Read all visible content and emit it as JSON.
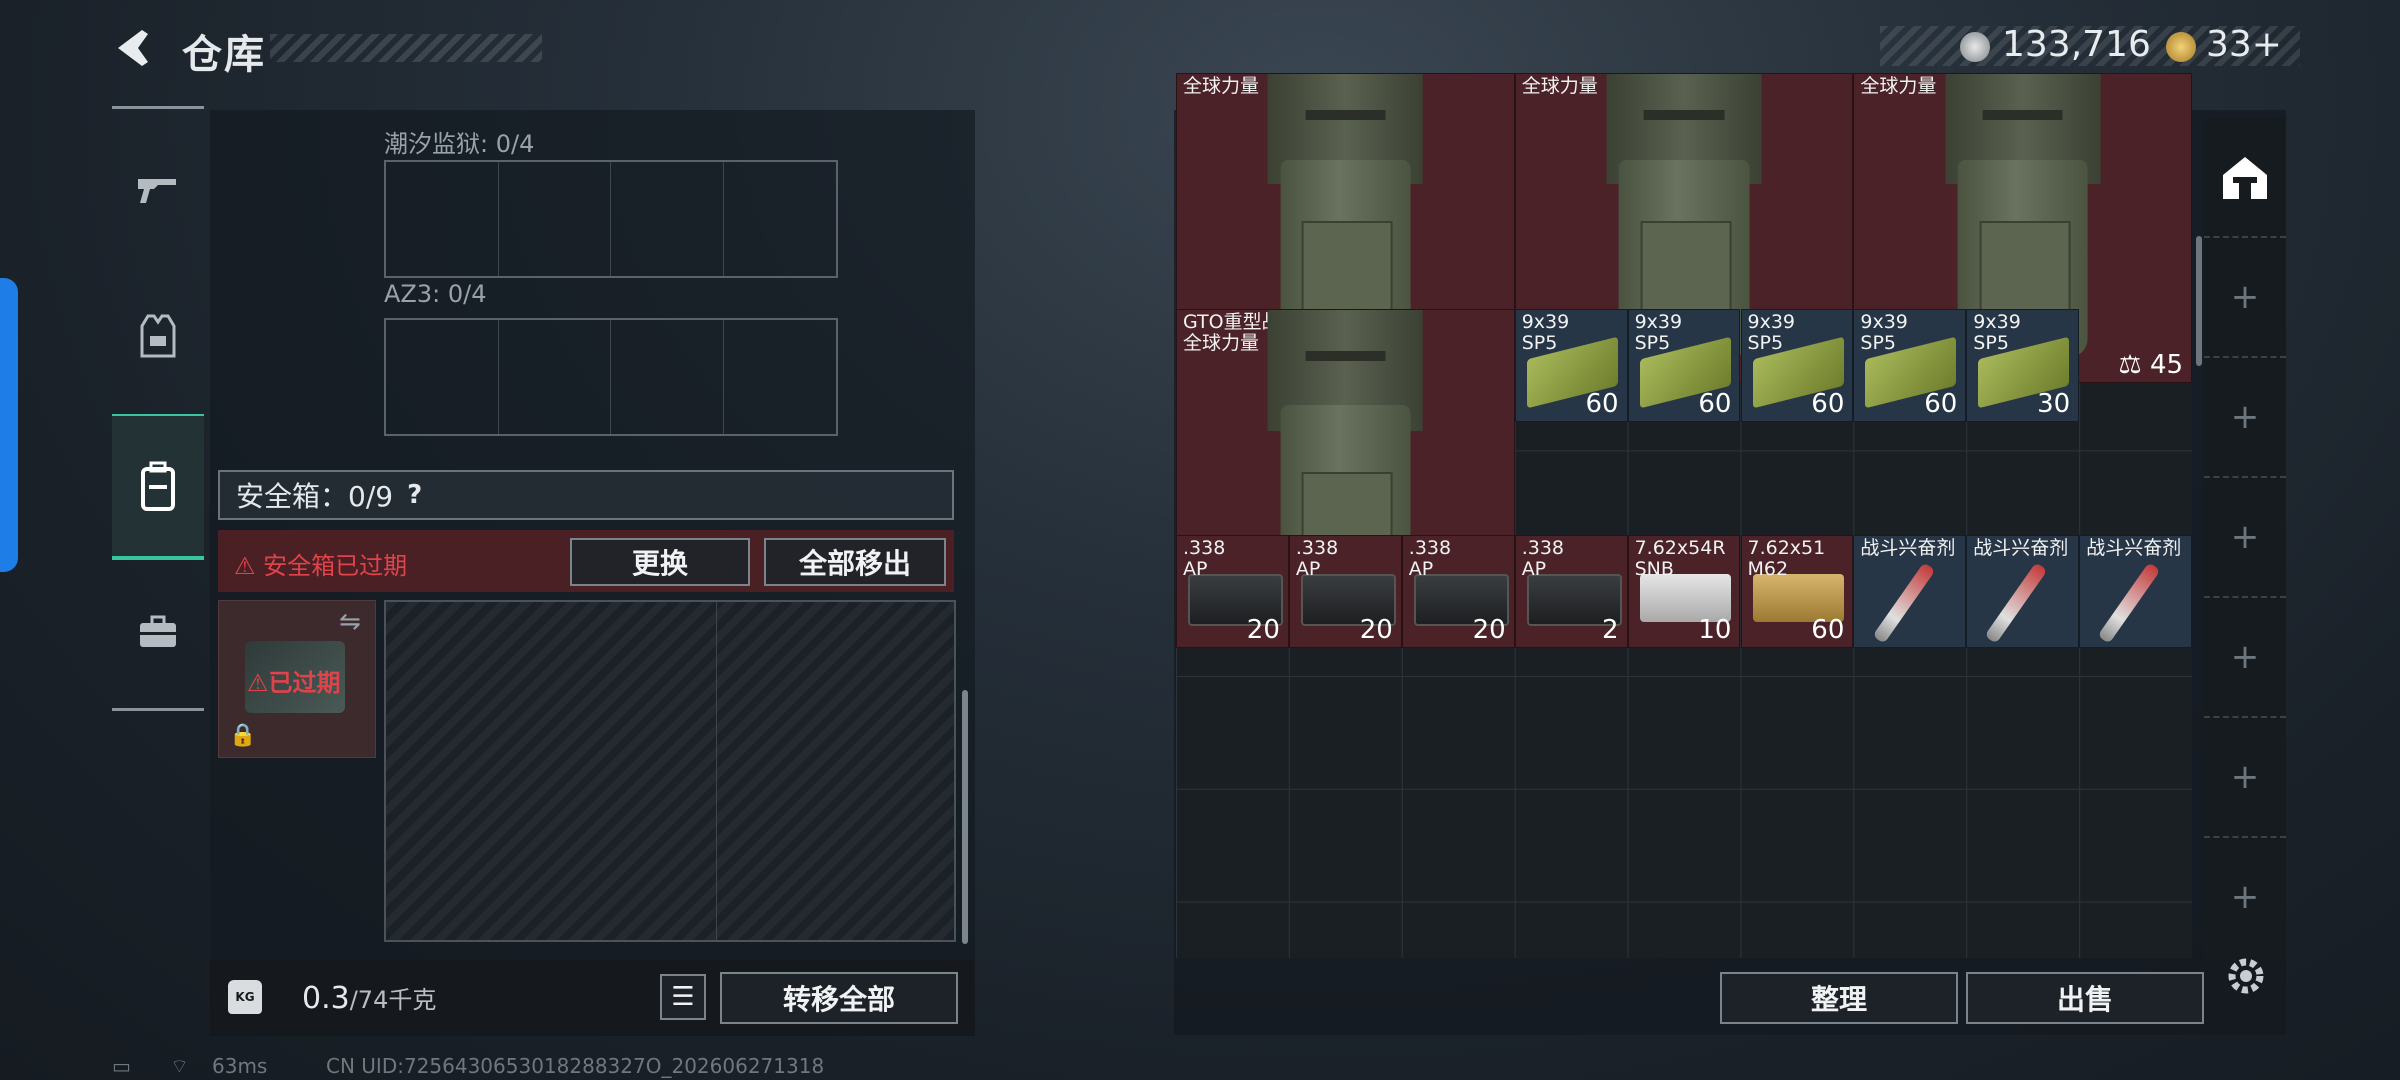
{
  "header": {
    "title": "仓库",
    "currency1": "133,716",
    "currency2": "33+"
  },
  "left_panel": {
    "sections": [
      {
        "label": "潮汐监狱: 0/4"
      },
      {
        "label": "AZ3: 0/4"
      }
    ],
    "safe_box": {
      "label": "安全箱：0/9",
      "help": "?",
      "warning": "安全箱已过期",
      "replace_button": "更换",
      "remove_all_button": "全部移出",
      "expired_label": "已过期"
    },
    "weight_current": "0.3",
    "weight_total": "/74千克",
    "weight_icon_label": "KG",
    "transfer_all_button": "转移全部"
  },
  "inventory": {
    "backpack_name_cut": "全球力量",
    "backpack_full_name": "GTO重型战术包\n全球力量",
    "backpack_cap": "45",
    "ammo_9x39": [
      {
        "name": "9x39\nSP5",
        "count": "60"
      },
      {
        "name": "9x39\nSP5",
        "count": "60"
      },
      {
        "name": "9x39\nSP5",
        "count": "60"
      },
      {
        "name": "9x39\nSP5",
        "count": "60"
      },
      {
        "name": "9x39\nSP5",
        "count": "30"
      }
    ],
    "row3": [
      {
        "name": ".338\nAP",
        "count": "20"
      },
      {
        "name": ".338\nAP",
        "count": "20"
      },
      {
        "name": ".338\nAP",
        "count": "20"
      },
      {
        "name": ".338\nAP",
        "count": "2"
      },
      {
        "name": "7.62x54R\nSNB",
        "count": "10"
      },
      {
        "name": "7.62x51\nM62",
        "count": "60"
      },
      {
        "name": "战斗兴奋剂",
        "count": ""
      },
      {
        "name": "战斗兴奋剂",
        "count": ""
      },
      {
        "name": "战斗兴奋剂",
        "count": ""
      }
    ],
    "sort_button": "整理",
    "sell_button": "出售"
  },
  "footer": {
    "ping": "63ms",
    "uid": "CN UID:7256430653018288327O_202606271318"
  },
  "colors": {
    "accent": "#37c7a0",
    "warning": "#e0434a",
    "edge_tab": "#1e7de6"
  }
}
